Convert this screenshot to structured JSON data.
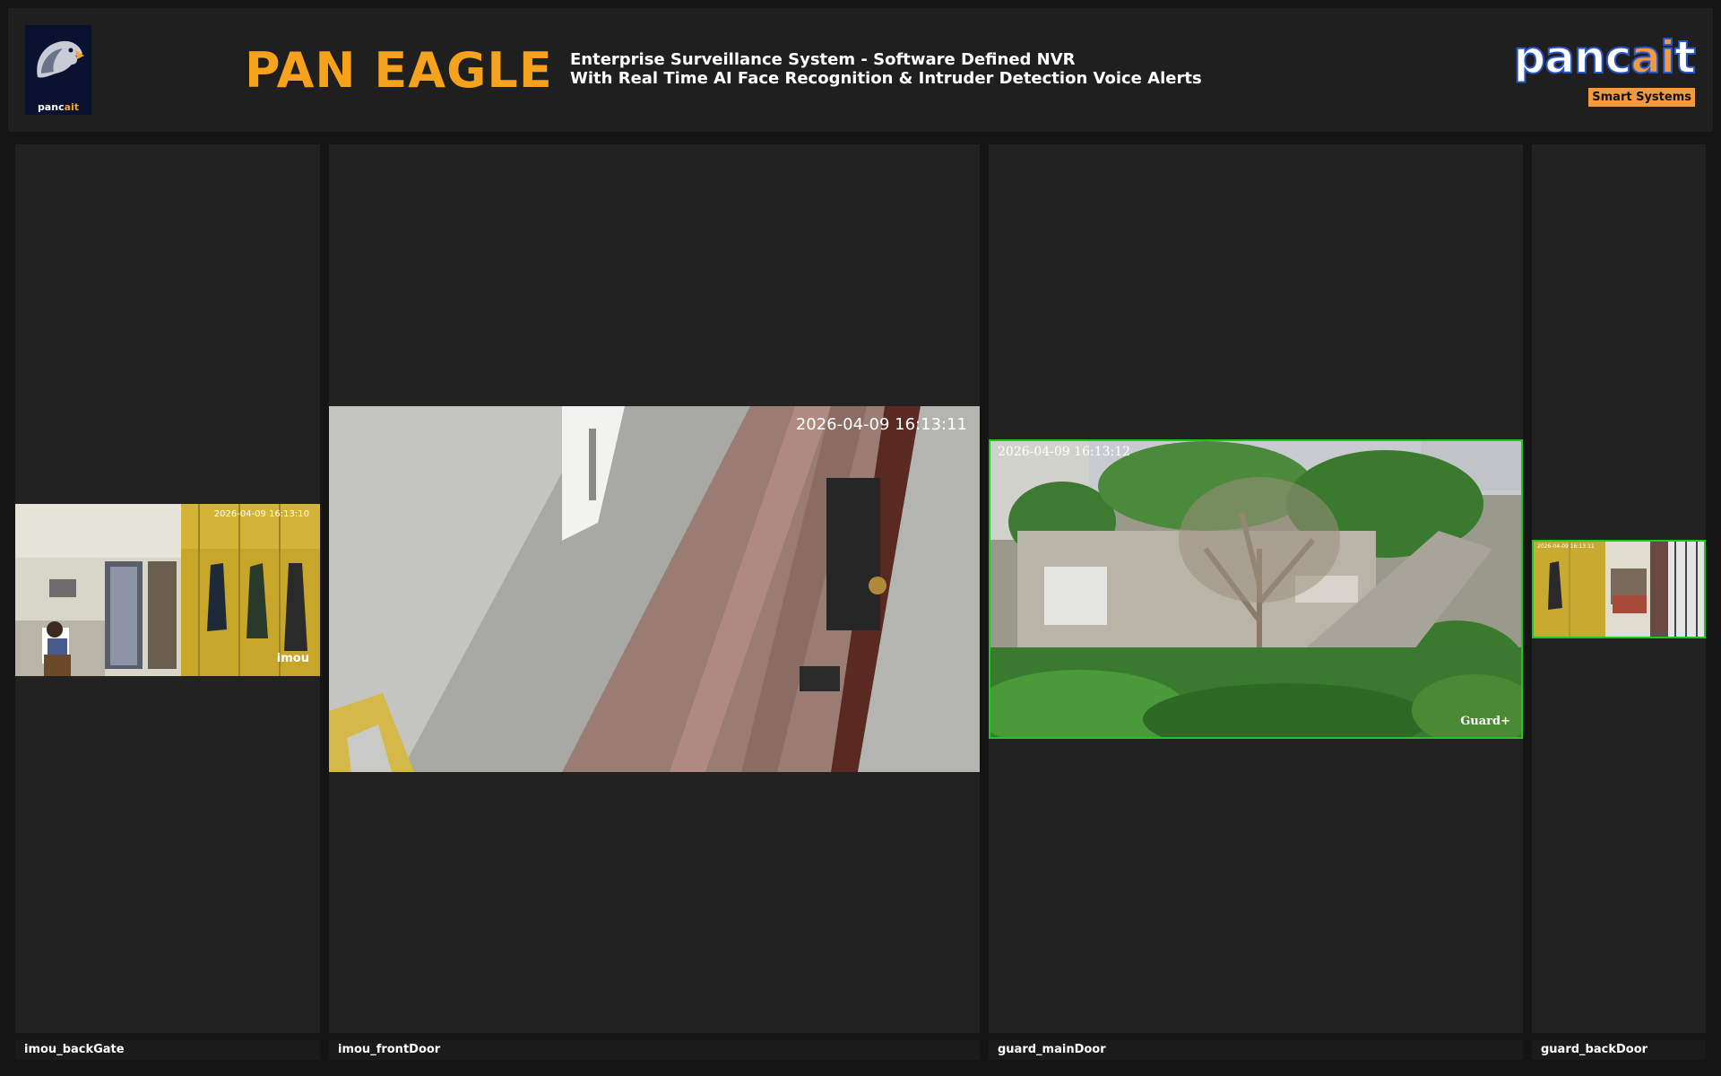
{
  "header": {
    "logo_text_left": "panc",
    "logo_text_right": "ait",
    "title": "PAN EAGLE",
    "subtitle_line1": "Enterprise Surveillance System - Software Defined NVR",
    "subtitle_line2": "With Real Time AI Face Recognition & Intruder Detection Voice Alerts",
    "brand": {
      "word_left": "panc",
      "word_ai": "ai",
      "word_right": "t",
      "badge": "Smart Systems"
    }
  },
  "cameras": [
    {
      "name": "imou_backGate",
      "timestamp": "2026-04-09 16:13:10",
      "overlay_brand": "imou",
      "active": false
    },
    {
      "name": "imou_frontDoor",
      "timestamp": "2026-04-09 16:13:11",
      "overlay_brand": "",
      "active": false
    },
    {
      "name": "guard_mainDoor",
      "timestamp": "2026-04-09 16:13:12",
      "overlay_brand": "Guard+",
      "active": true
    },
    {
      "name": "guard_backDoor",
      "timestamp": "2026-04-09 16:13:11",
      "overlay_brand": "",
      "active": true
    }
  ],
  "colors": {
    "title": "#f7a21c",
    "active_border": "#1ec81e",
    "brand_blue": "#2a55c8",
    "brand_orange": "#f39a3c"
  }
}
